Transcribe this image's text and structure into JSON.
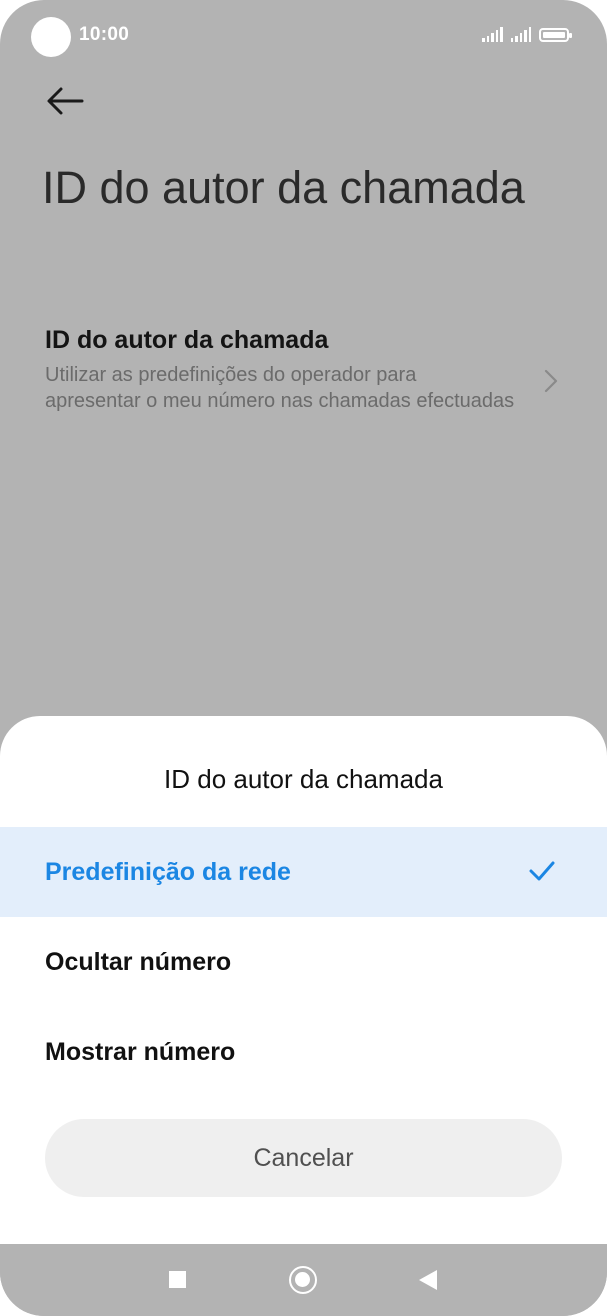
{
  "status_bar": {
    "time": "10:00",
    "icons": [
      "signal-icon",
      "signal-icon",
      "battery-icon"
    ]
  },
  "page": {
    "back_icon": "arrow-left-icon",
    "title": "ID do autor da chamada",
    "setting": {
      "title": "ID do autor da chamada",
      "description": "Utilizar as predefinições do operador para apresentar o meu número nas chamadas efectuadas",
      "chevron_icon": "chevron-right-icon"
    }
  },
  "sheet": {
    "title": "ID do autor da chamada",
    "options": [
      {
        "label": "Predefinição da rede",
        "selected": true
      },
      {
        "label": "Ocultar número",
        "selected": false
      },
      {
        "label": "Mostrar número",
        "selected": false
      }
    ],
    "cancel_label": "Cancelar"
  },
  "nav_bar": {
    "icons": [
      "square-recents-icon",
      "circle-home-icon",
      "triangle-back-icon"
    ]
  },
  "colors": {
    "scrim": "#b3b3b3",
    "accent": "#1b86e3",
    "selected_bg": "#e3eefb",
    "cancel_bg": "#efefef"
  }
}
